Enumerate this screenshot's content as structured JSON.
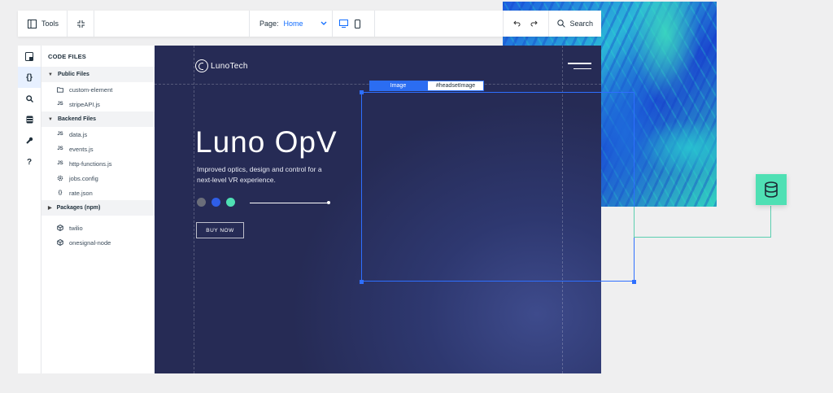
{
  "toolbar": {
    "tools_label": "Tools",
    "page_prefix": "Page:",
    "page_value": "Home",
    "search_label": "Search"
  },
  "rail": {
    "items": [
      "files-icon",
      "code-icon",
      "search-icon",
      "database-icon",
      "wrench-icon",
      "help-icon"
    ],
    "code_glyph": "{}",
    "help_glyph": "?"
  },
  "files": {
    "title": "CODE FILES",
    "public": {
      "label": "Public Files",
      "items": [
        {
          "icon": "folder-icon",
          "name": "custom-element"
        },
        {
          "icon": "js-icon",
          "name": "stripeAPI.js"
        }
      ]
    },
    "backend": {
      "label": "Backend Files",
      "items": [
        {
          "icon": "js-icon",
          "name": "data.js"
        },
        {
          "icon": "js-icon",
          "name": "events.js"
        },
        {
          "icon": "js-icon",
          "name": "http-functions.js"
        },
        {
          "icon": "gear-icon",
          "name": "jobs.config"
        },
        {
          "icon": "json-icon",
          "name": "rate.json"
        }
      ]
    },
    "packages": {
      "label": "Packages (npm)",
      "items": [
        {
          "icon": "package-icon",
          "name": "twilio"
        },
        {
          "icon": "package-icon",
          "name": "onesignal-node"
        }
      ]
    },
    "js_glyph": "JS",
    "json_glyph": "{}"
  },
  "site": {
    "logo": "LunoTech",
    "hero_title": "Luno OpV",
    "hero_sub": "Improved optics, design and control for a next-level VR experience.",
    "button": "BUY NOW",
    "dot_colors": [
      "#6b6e7a",
      "#2f5ee6",
      "#4fe0b4"
    ]
  },
  "selection": {
    "type_label": "Image",
    "id_label": "#headsetImage"
  },
  "colors": {
    "accent": "#116dff",
    "db_green": "#4fe0b4",
    "canvas_dark": "#262b55"
  }
}
